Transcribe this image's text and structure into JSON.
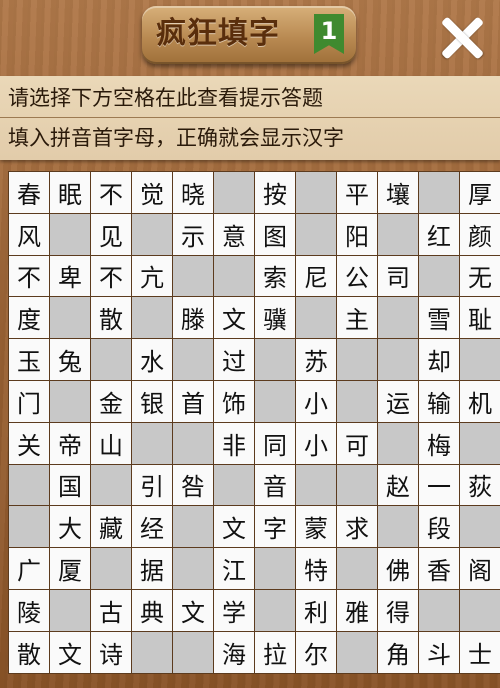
{
  "header": {
    "title": "疯狂填字",
    "level": "1"
  },
  "hints": {
    "line1": "请选择下方空格在此查看提示答题",
    "line2": "填入拼音首字母，正确就会显示汉字"
  },
  "grid": [
    [
      "春",
      "眠",
      "不",
      "觉",
      "晓",
      "",
      "按",
      "",
      "平",
      "壤",
      "",
      "厚"
    ],
    [
      "风",
      "",
      "见",
      "",
      "示",
      "意",
      "图",
      "",
      "阳",
      "",
      "红",
      "颜"
    ],
    [
      "不",
      "卑",
      "不",
      "亢",
      "",
      "",
      "索",
      "尼",
      "公",
      "司",
      "",
      "无"
    ],
    [
      "度",
      "",
      "散",
      "",
      "滕",
      "文",
      "骥",
      "",
      "主",
      "",
      "雪",
      "耻"
    ],
    [
      "玉",
      "兔",
      "",
      "水",
      "",
      "过",
      "",
      "苏",
      "",
      "",
      "却",
      ""
    ],
    [
      "门",
      "",
      "金",
      "银",
      "首",
      "饰",
      "",
      "小",
      "",
      "运",
      "输",
      "机"
    ],
    [
      "关",
      "帝",
      "山",
      "",
      "",
      "非",
      "同",
      "小",
      "可",
      "",
      "梅",
      ""
    ],
    [
      "",
      "国",
      "",
      "引",
      "咎",
      "",
      "音",
      "",
      "",
      "赵",
      "一",
      "荻"
    ],
    [
      "",
      "大",
      "藏",
      "经",
      "",
      "文",
      "字",
      "蒙",
      "求",
      "",
      "段",
      ""
    ],
    [
      "广",
      "厦",
      "",
      "据",
      "",
      "江",
      "",
      "特",
      "",
      "佛",
      "香",
      "阁"
    ],
    [
      "陵",
      "",
      "古",
      "典",
      "文",
      "学",
      "",
      "利",
      "雅",
      "得",
      "",
      ""
    ],
    [
      "散",
      "文",
      "诗",
      "",
      "",
      "海",
      "拉",
      "尔",
      "",
      "角",
      "斗",
      "士"
    ]
  ],
  "cell_colors": {
    "filled": "#fafafa",
    "blocked": "#c8c8c8",
    "grid_line": "#5c3b1e"
  }
}
